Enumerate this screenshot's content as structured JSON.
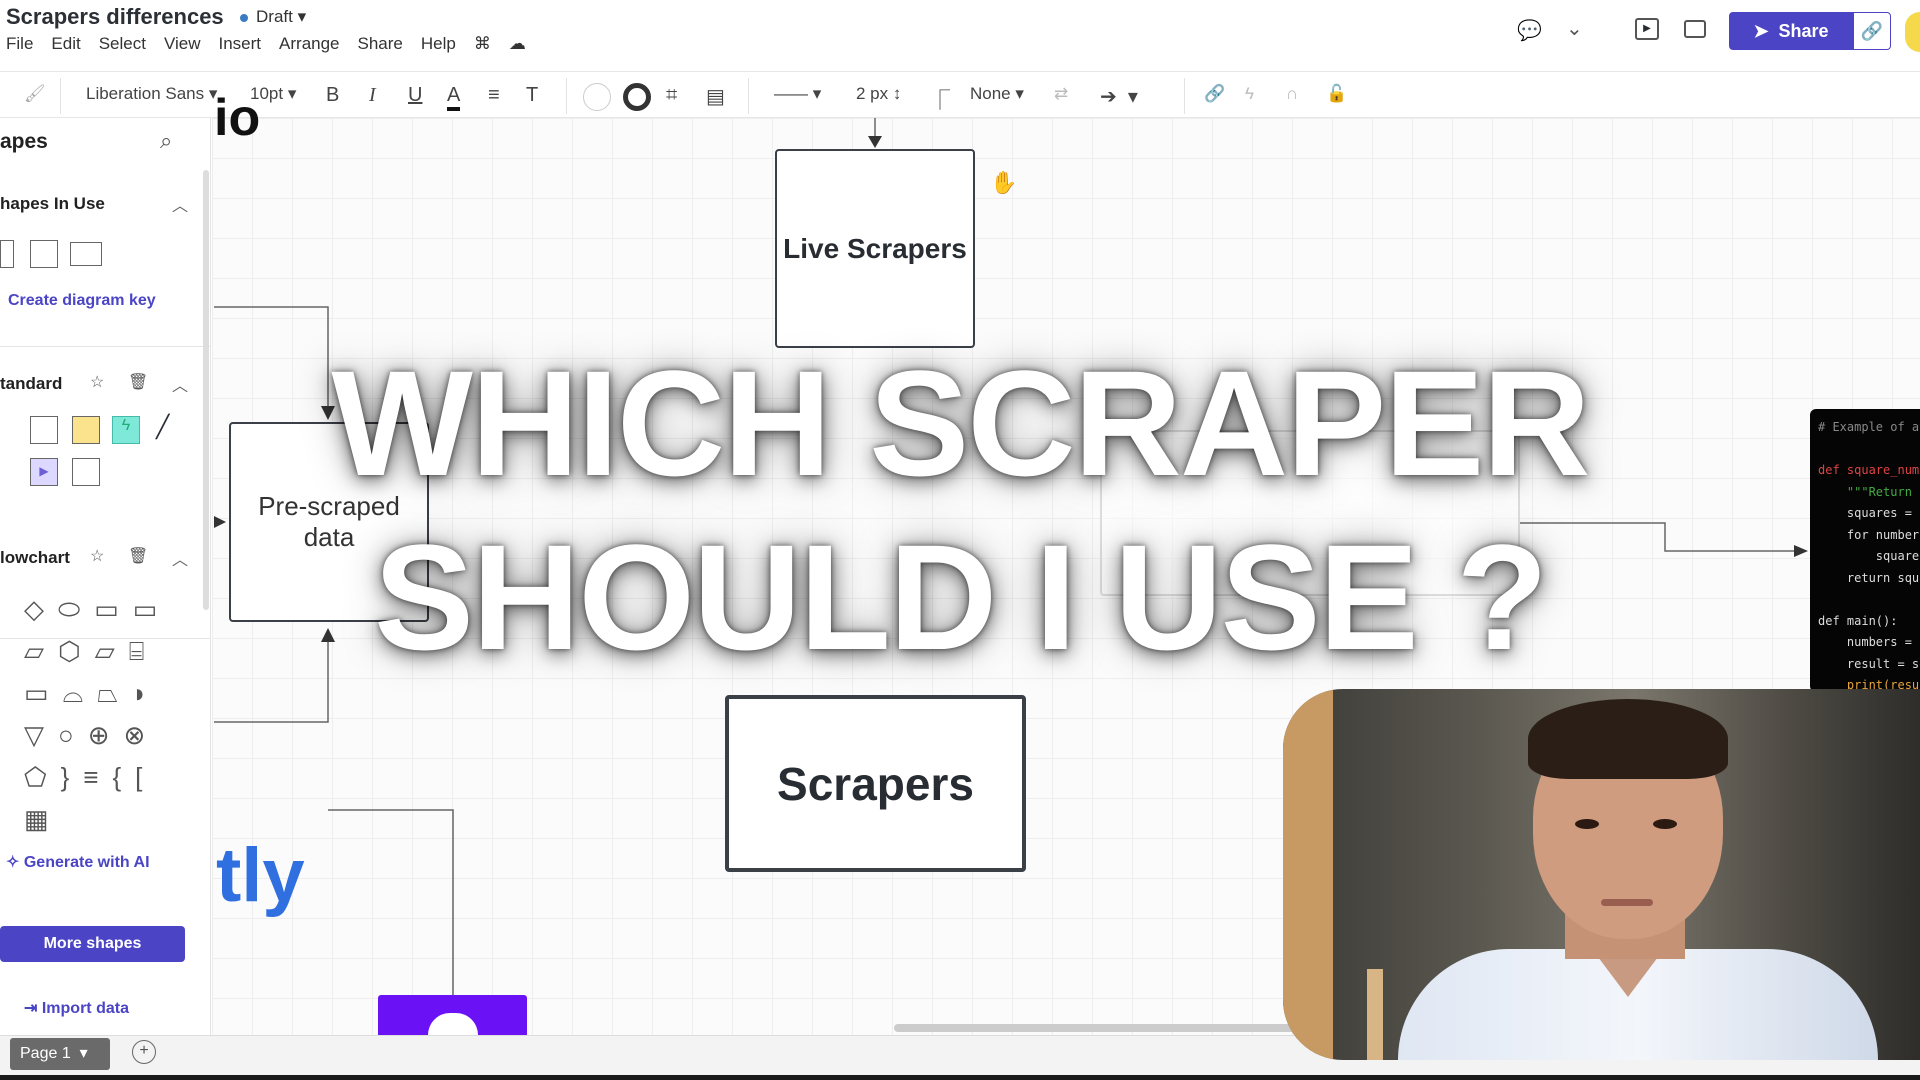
{
  "header": {
    "title": "Scrapers differences",
    "status": "Draft",
    "menu": [
      "File",
      "Edit",
      "Select",
      "View",
      "Insert",
      "Arrange",
      "Share",
      "Help"
    ],
    "share_label": "Share"
  },
  "toolbar": {
    "font": "Liberation Sans",
    "font_size": "10pt",
    "bold": "B",
    "italic": "I",
    "underline": "U",
    "font_color": "A",
    "text_options": "T",
    "line_width": "2 px",
    "line_end": "None"
  },
  "sidebar": {
    "title": "apes",
    "shapes_in_use": "hapes In Use",
    "create_key": "Create diagram key",
    "standard": "tandard",
    "flowchart": "lowchart",
    "generate_ai": "Generate with AI",
    "more_shapes": "More shapes",
    "import_data": "Import data"
  },
  "canvas": {
    "live_scrapers": "Live Scrapers",
    "pre_scraped": "Pre-scraped data",
    "scrapers": "Scrapers",
    "partial_top": "io",
    "partial_bottom": "tly"
  },
  "overlay": {
    "line1": "WHICH SCRAPER",
    "line2": "SHOULD I USE ?"
  },
  "code": {
    "lines": [
      "# Example of av",
      "",
      "def square_numb",
      "    \"\"\"Return a",
      "    squares = [",
      "    for number",
      "        squares",
      "    return squa",
      "",
      "def main():",
      "    numbers = [",
      "    result = sq",
      "    print(resul"
    ]
  },
  "footer": {
    "page": "Page 1"
  },
  "colors": {
    "accent": "#4b45c6",
    "tly": "#2f6fe0",
    "purple_shape": "#6a12f5"
  }
}
